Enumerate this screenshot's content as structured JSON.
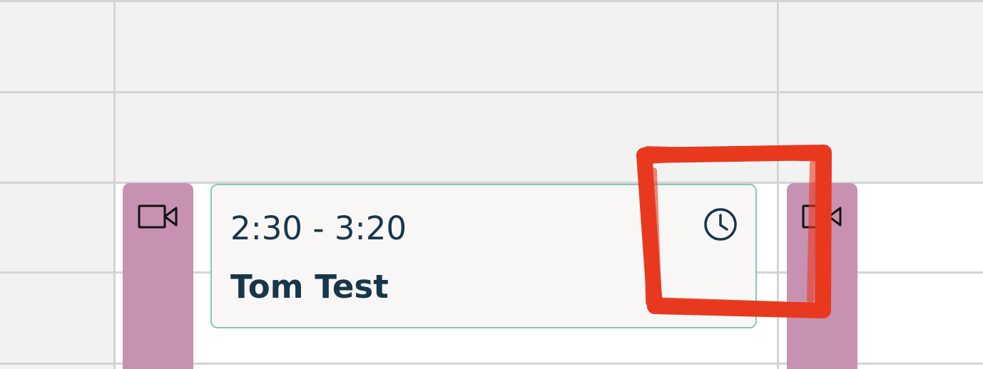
{
  "event": {
    "time": "2:30 - 3:20",
    "name": "Tom Test",
    "status_icon": "clock-icon"
  },
  "side_blocks": [
    {
      "icon": "video-camera-icon"
    },
    {
      "icon": "video-camera-icon"
    }
  ],
  "annotation": {
    "type": "hand-drawn-box",
    "target": "clock-icon"
  },
  "colors": {
    "grid_background": "#f2f2f2",
    "grid_line": "#d4d4d4",
    "video_block": "#c792b2",
    "event_border": "#86c7bf",
    "event_background": "#f8f7f6",
    "event_text": "#17364a",
    "annotation": "#e8391f"
  }
}
